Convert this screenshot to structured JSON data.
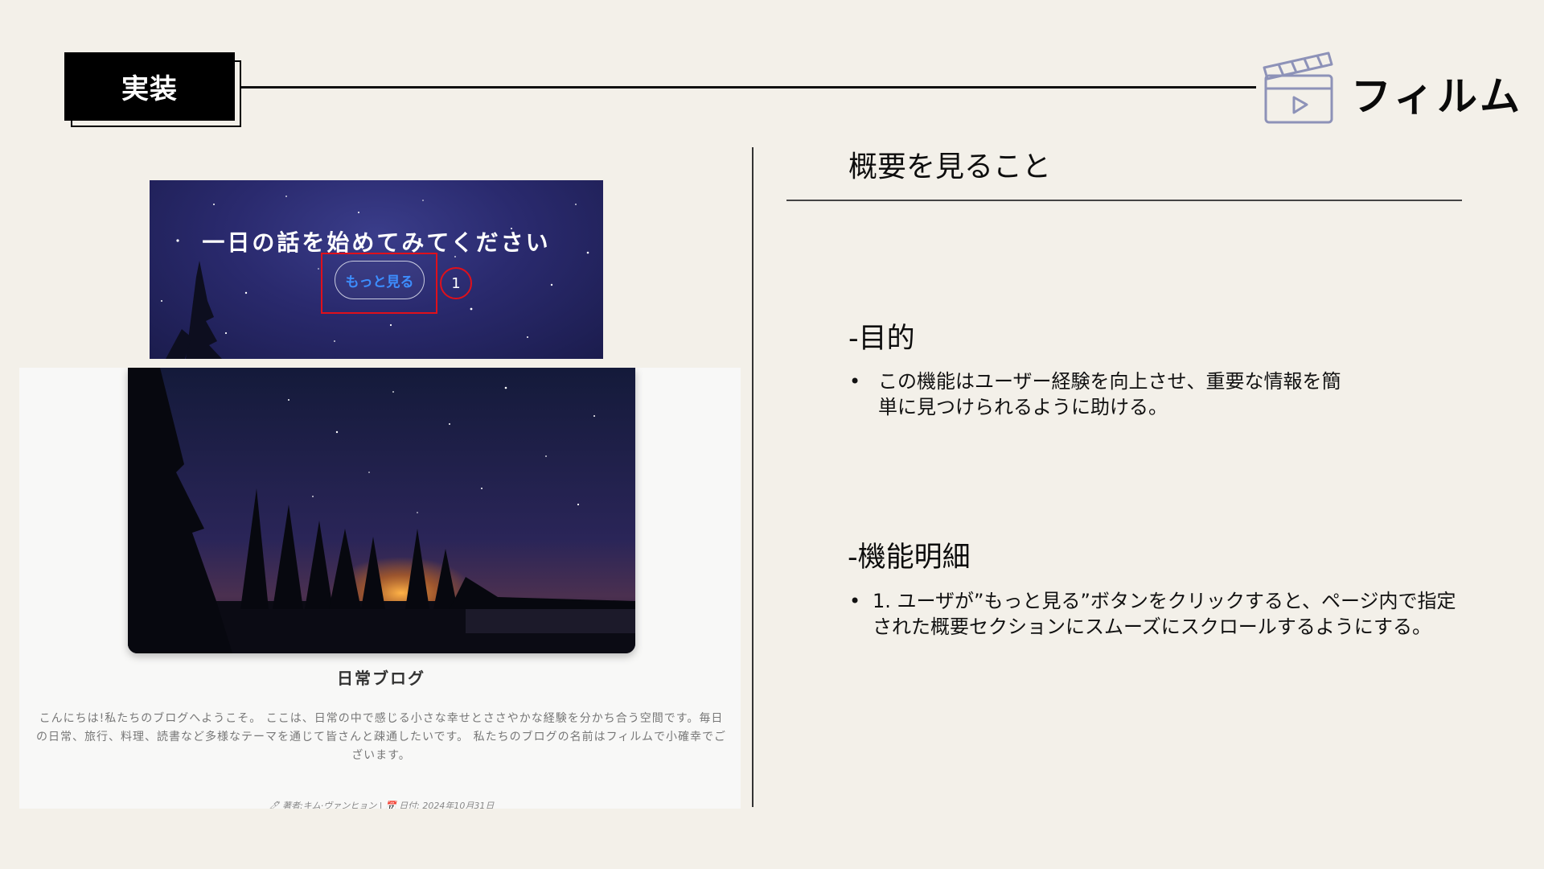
{
  "header": {
    "section_label": "実装",
    "brand": "フィルム",
    "icon": "clapperboard-icon"
  },
  "hero": {
    "title": "一日の話を始めてみてください",
    "button_label": "もっと見る",
    "marker_number": "1",
    "highlight_color": "#e0101b",
    "button_text_color": "#3d8eff"
  },
  "blog": {
    "title": "日常ブログ",
    "text": "こんにちは!私たちのブログへようこそ。 ここは、日常の中で感じる小さな幸せとささやかな経験を分かち合う空間です。毎日の日常、旅行、料理、読書など多様なテーマを通じて皆さんと疎通したいです。 私たちのブログの名前はフィルムで小確幸でございます。",
    "meta": "🖊 著者:キム·ヴァンヒョン | 📅 日付: 2024年10月31日"
  },
  "right": {
    "overview_title": "概要を見ること",
    "purpose_heading": "-目的",
    "purpose_bullet": "この機能はユーザー経験を向上させ、重要な情報を簡\n単に見つけられるように助ける。",
    "feature_heading": "-機能明細",
    "feature_bullet": "1.  ユーザが”もっと見る”ボタンをクリックすると、ページ内で指定\nされた概要セクションにスムーズにスクロールするようにする。"
  }
}
